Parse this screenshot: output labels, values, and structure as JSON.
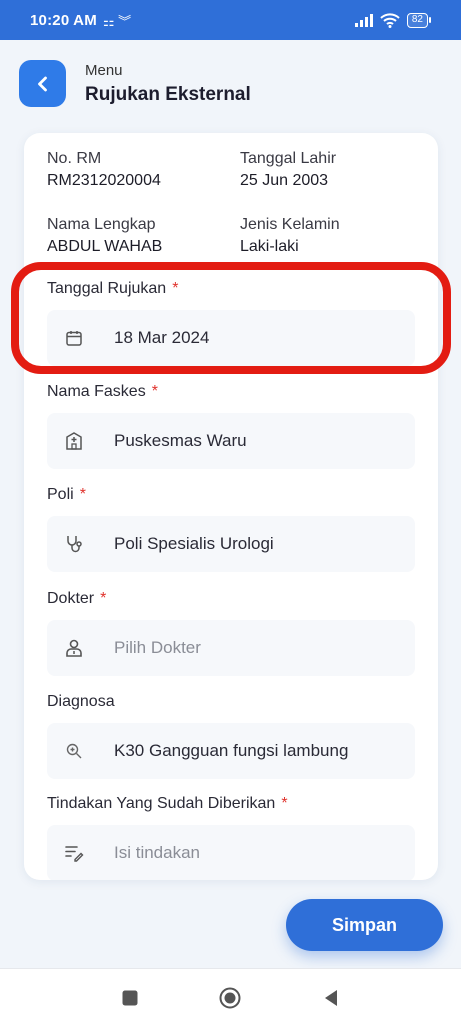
{
  "status_bar": {
    "time": "10:20 AM",
    "icons": "⚏ ︾",
    "battery": "82"
  },
  "header": {
    "menu_label": "Menu",
    "title": "Rujukan Eksternal"
  },
  "patient": {
    "rm_label": "No. RM",
    "rm_value": "RM2312020004",
    "dob_label": "Tanggal Lahir",
    "dob_value": "25 Jun 2003",
    "name_label": "Nama Lengkap",
    "name_value": "ABDUL WAHAB",
    "gender_label": "Jenis Kelamin",
    "gender_value": "Laki-laki"
  },
  "form": {
    "tanggal_rujukan": {
      "label": "Tanggal Rujukan",
      "required": "*",
      "value": "18 Mar 2024",
      "icon": "calendar-icon"
    },
    "nama_faskes": {
      "label": "Nama Faskes",
      "required": "*",
      "value": "Puskesmas Waru",
      "icon": "hospital-icon"
    },
    "poli": {
      "label": "Poli",
      "required": "*",
      "value": "Poli Spesialis Urologi",
      "icon": "stethoscope-icon"
    },
    "dokter": {
      "label": "Dokter",
      "required": "*",
      "placeholder": "Pilih Dokter",
      "icon": "doctor-icon"
    },
    "diagnosa": {
      "label": "Diagnosa",
      "value": "K30 Gangguan fungsi lambung",
      "icon": "zoom-search-icon"
    },
    "tindakan": {
      "label": "Tindakan Yang Sudah Diberikan",
      "required": "*",
      "placeholder": "Isi tindakan",
      "icon": "edit-list-icon"
    }
  },
  "actions": {
    "save_label": "Simpan"
  },
  "colors": {
    "primary": "#2f6fd8",
    "required": "#e0322c",
    "highlight": "#e31c12"
  }
}
